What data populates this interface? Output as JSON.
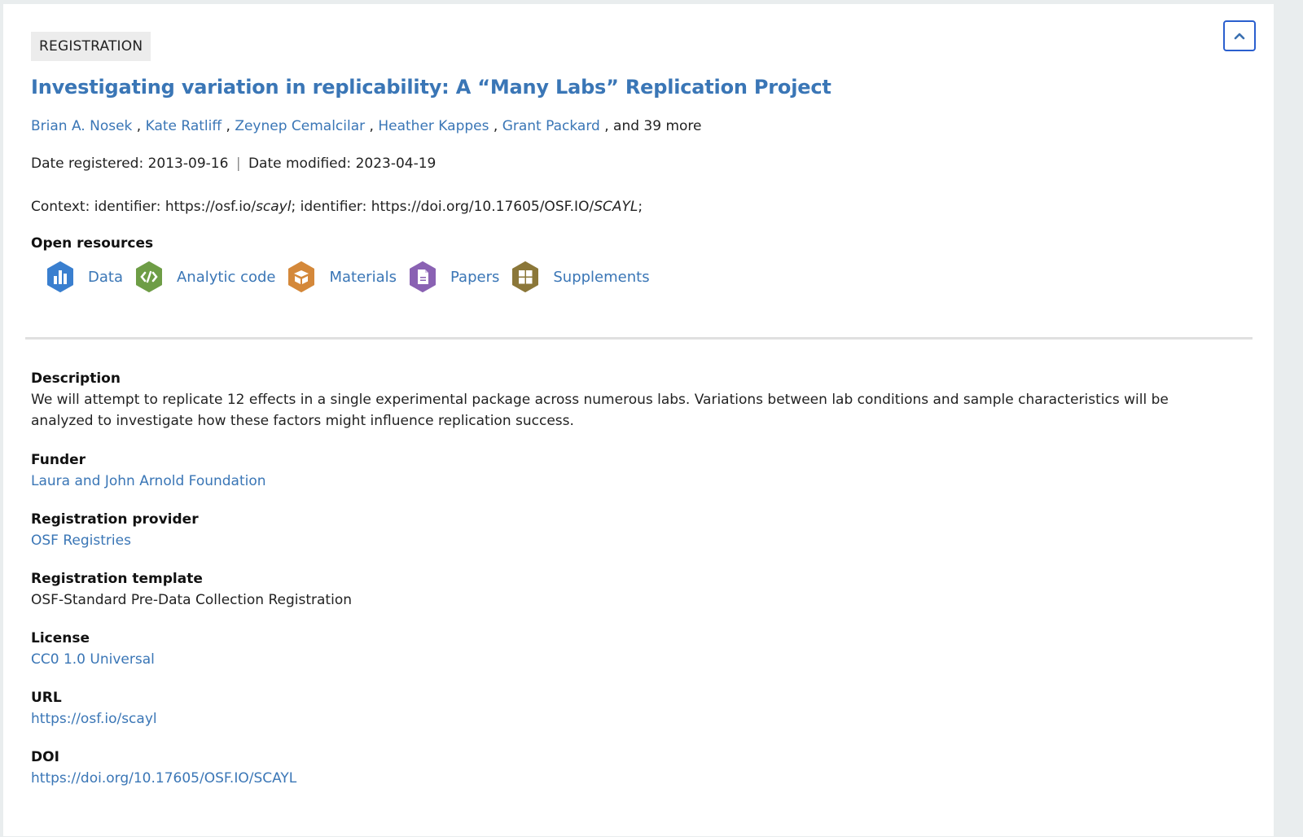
{
  "badge": "REGISTRATION",
  "collapse_button": {
    "icon": "chevron-up-icon"
  },
  "title": "Investigating variation in replicability: A “Many Labs” Replication Project",
  "authors": {
    "names": [
      "Brian A. Nosek",
      "Kate Ratliff",
      "Zeynep Cemalcilar",
      "Heather Kappes",
      "Grant Packard"
    ],
    "more": ", and 39 more"
  },
  "dates": {
    "registered_label": "Date registered:",
    "registered": "2013-09-16",
    "separator": "|",
    "modified_label": "Date modified:",
    "modified": "2023-04-19"
  },
  "context": {
    "prefix": "Context: identifier: https://osf.io/",
    "id1": "scayl",
    "middle": "; identifier: https://doi.org/10.17605/OSF.IO/",
    "id2": "SCAYL",
    "suffix": ";"
  },
  "open_resources": {
    "label": "Open resources",
    "items": [
      {
        "label": "Data",
        "icon": "bar-chart-icon",
        "color": "#3a7fcf"
      },
      {
        "label": "Analytic code",
        "icon": "code-icon",
        "color": "#6e9d46"
      },
      {
        "label": "Materials",
        "icon": "box-icon",
        "color": "#d4883a"
      },
      {
        "label": "Papers",
        "icon": "document-icon",
        "color": "#8a62b3"
      },
      {
        "label": "Supplements",
        "icon": "grid-icon",
        "color": "#8b7739"
      }
    ]
  },
  "fields": {
    "description": {
      "label": "Description",
      "value": "We will attempt to replicate 12 effects in a single experimental package across numerous labs. Variations between lab conditions and sample characteristics will be analyzed to investigate how these factors might influence replication success."
    },
    "funder": {
      "label": "Funder",
      "value": "Laura and John Arnold Foundation"
    },
    "provider": {
      "label": "Registration provider",
      "value": "OSF Registries"
    },
    "template": {
      "label": "Registration template",
      "value": "OSF-Standard Pre-Data Collection Registration"
    },
    "license": {
      "label": "License",
      "value": "CC0 1.0 Universal"
    },
    "url": {
      "label": "URL",
      "value": "https://osf.io/scayl"
    },
    "doi": {
      "label": "DOI",
      "value": "https://doi.org/10.17605/OSF.IO/SCAYL"
    }
  },
  "colors": {
    "link": "#3a76b6",
    "button_border": "#2a5fce",
    "background": "#e9edee"
  }
}
